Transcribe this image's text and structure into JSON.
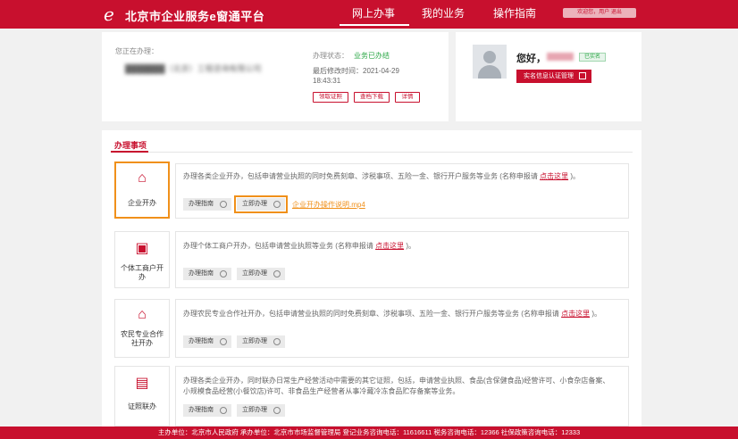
{
  "header": {
    "logo_glyph": "e",
    "title": "北京市企业服务e窗通平台",
    "nav": [
      "网上办事",
      "我的业务",
      "操作指南"
    ],
    "user_text": "欢迎您，用户  退出"
  },
  "status_card": {
    "current_label": "您正在办理：",
    "company_name": "███████（北京）工程咨询有限公司",
    "status_key": "办理状态：",
    "status_value": "业务已办结",
    "modified_time": "最后修改时间：2021-04-29 18:43:31",
    "buttons": [
      "领取证照",
      "查档下载",
      "详情"
    ]
  },
  "user_card": {
    "greeting": "您好，",
    "auth_badge": "已实名",
    "auth_button": "实名信息认证管理"
  },
  "main": {
    "tab_label": "办理事项",
    "items": [
      {
        "label": "企业开办",
        "icon": "building-up-icon",
        "desc_pre": "办理各类企业开办，包括申请营业执照的同时免费刻章、涉税事项、五险一金、银行开户服务等业务 (名称申报请 ",
        "link": "点击这里",
        "desc_post": " )。",
        "guide": "办理指南",
        "go": "立即办理",
        "video": "企业开办操作说明.mp4"
      },
      {
        "label": "个体工商户开办",
        "icon": "id-card-icon",
        "desc_pre": "办理个体工商户开办，包括申请营业执照等业务 (名称申报请 ",
        "link": "点击这里",
        "desc_post": " )。",
        "guide": "办理指南",
        "go": "立即办理"
      },
      {
        "label": "农民专业合作社开办",
        "icon": "house-icon",
        "desc_pre": "办理农民专业合作社开办，包括申请营业执照的同时免费刻章、涉税事项、五险一金、银行开户服务等业务 (名称申报请 ",
        "link": "点击这里",
        "desc_post": " )。",
        "guide": "办理指南",
        "go": "立即办理"
      },
      {
        "label": "证照联办",
        "icon": "certificate-icon",
        "desc_line1": "办理各类企业开办，同时联办日常生产经营活动中需要的其它证照，包括，申请营业执照、食品(含保健食品)经营许可、小食杂店备案、",
        "desc_line2": "小规模食品经营(小餐饮店)许可、非食品生产经营者从事冷藏冷冻食品贮存备案等业务。",
        "guide": "办理指南",
        "go": "立即办理"
      }
    ]
  },
  "footer": {
    "text": "主办单位：北京市人民政府   承办单位：北京市市场监督管理局   登记业务咨询电话：11616611   税务咨询电话：12366   社保政策咨询电话：12333"
  }
}
